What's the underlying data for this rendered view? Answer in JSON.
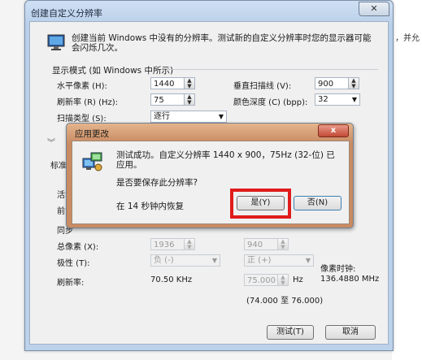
{
  "background": {
    "right_text": "，并允"
  },
  "window": {
    "title": "创建自定义分辨率",
    "close_glyph": "✕",
    "description": "创建当前 Windows 中没有的分辨率。测试新的自定义分辨率时您的显示器可能会闪烁几次。",
    "display_mode_label": "显示模式 (如 Windows 中所示)",
    "h_pixels_label": "水平像素 (H):",
    "h_pixels_value": "1440",
    "v_scan_label": "垂直扫描线 (V):",
    "v_scan_value": "900",
    "refresh_label": "刷新率 (R) (Hz):",
    "refresh_value": "75",
    "color_depth_label": "颜色深度 (C) (bpp):",
    "color_depth_value": "32",
    "scan_type_label": "扫描类型 (S):",
    "scan_type_value": "逐行",
    "standard_label": "标准",
    "active_label": "活动",
    "front_label": "前沿",
    "sync_label": "同步",
    "total_pixels_label": "总像素 (X):",
    "total_pixels_value": "1936",
    "total_lines_value": "940",
    "polarity_label": "极性 (T):",
    "polarity_h_value": "负 (-)",
    "polarity_v_value": "正 (+)",
    "pixel_clock_label": "像素时钟:",
    "pixel_clock_value": "136.4880 MHz",
    "refresh2_label": "刷新率:",
    "refresh2_value": "70.50 KHz",
    "refresh2_hz_value": "75.000",
    "hz_unit": "Hz",
    "range_text": "(74.000 至 76.000)",
    "test_button": "测试(T)",
    "cancel_button": "取消"
  },
  "dialog": {
    "title": "应用更改",
    "close_glyph": "x",
    "message": "测试成功。自定义分辨率 1440 x 900，75Hz (32-位) 已应用。",
    "question": "是否要保存此分辨率?",
    "timer": "在 14 秒钟内恢复",
    "yes_button": "是(Y)",
    "no_button": "否(N)"
  },
  "accent": {
    "highlight": "#e01b1b",
    "dialog_frame": "#c98b62",
    "window_frame": "#bcd1ea"
  }
}
